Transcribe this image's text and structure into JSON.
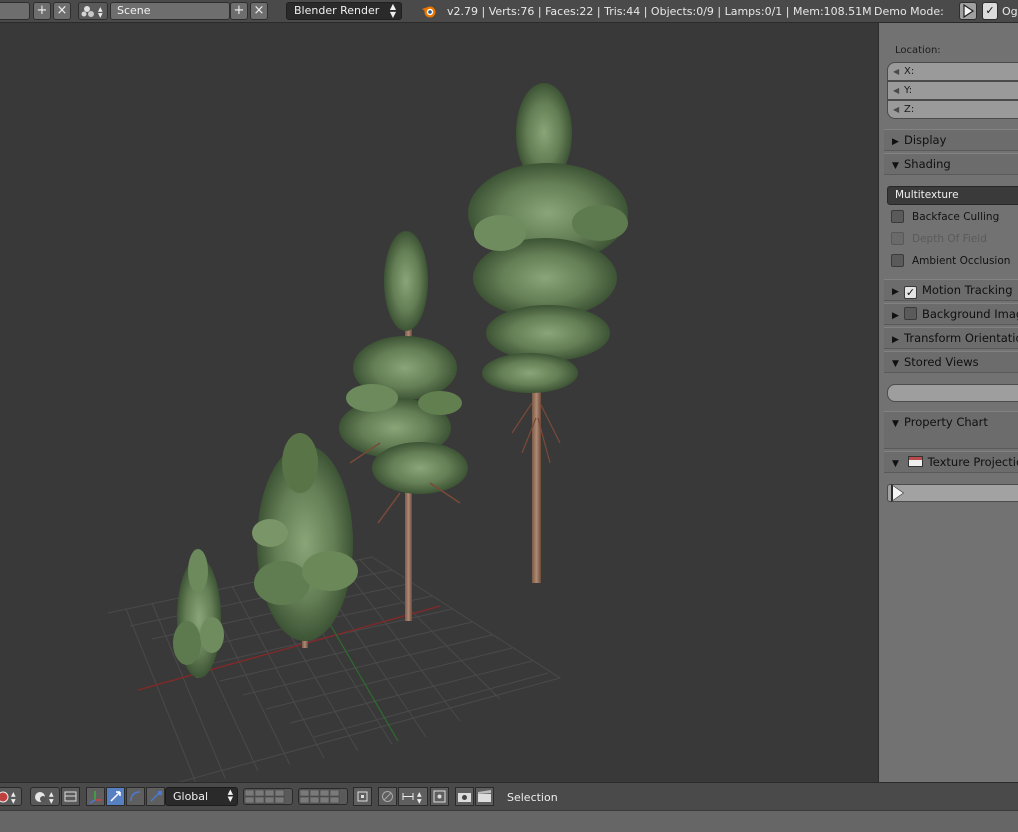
{
  "header": {
    "screen_field": "",
    "scene_name": "Scene",
    "render_engine": "Blender Render",
    "stats": "v2.79 | Verts:76 | Faces:22 | Tris:44 | Objects:0/9 | Lamps:0/1 | Mem:108.51M",
    "demo_mode_label": "Demo Mode:",
    "cut_label": "Og"
  },
  "panel": {
    "location_label": "Location:",
    "loc_x": "X:",
    "loc_y": "Y:",
    "loc_z": "Z:",
    "display": "Display",
    "shading": "Shading",
    "shading_mode": "Multitexture",
    "backface_culling": "Backface Culling",
    "depth_of_field": "Depth Of Field",
    "ambient_occlusion": "Ambient Occlusion",
    "motion_tracking": "Motion Tracking",
    "background_images": "Background Imag",
    "transform_orientations": "Transform Orientatio",
    "stored_views": "Stored Views",
    "property_chart": "Property Chart",
    "texture_projection": "Texture Projection"
  },
  "footer": {
    "orientation": "Global",
    "selection": "Selection"
  },
  "colors": {
    "viewport_bg": "#393939",
    "panel_bg": "#727272",
    "accent": "#5680c2",
    "x_axis": "#8a2a2a",
    "y_axis": "#2a7a2a"
  }
}
